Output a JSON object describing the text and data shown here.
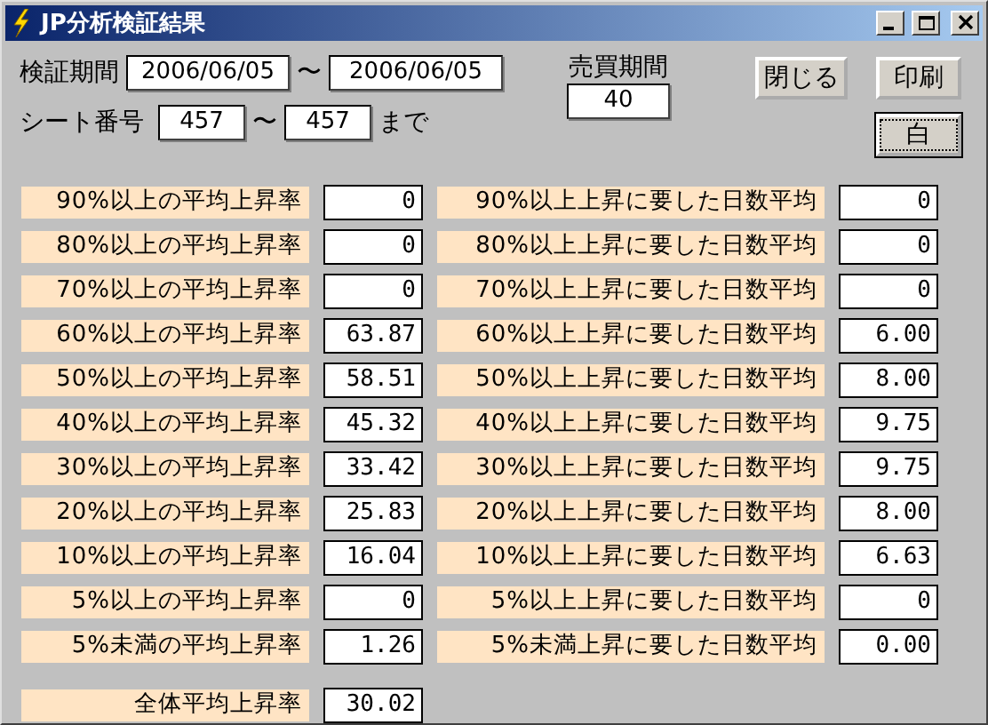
{
  "window": {
    "title": "JP分析検証結果"
  },
  "period": {
    "label": "検証期間",
    "from": "2006/06/05",
    "separator": "〜",
    "to": "2006/06/05"
  },
  "sheet": {
    "label": "シート番号",
    "from": "457",
    "separator": "〜",
    "to": "457",
    "suffix": "まで"
  },
  "trade_period": {
    "label": "売買期間",
    "value": "40"
  },
  "buttons": [
    {
      "label": "閉じる",
      "default": false
    },
    {
      "label": "印刷",
      "default": false
    },
    {
      "label": "白",
      "default": true
    }
  ],
  "rise_rates": [
    {
      "label": "90%以上の平均上昇率",
      "value": "0"
    },
    {
      "label": "80%以上の平均上昇率",
      "value": "0"
    },
    {
      "label": "70%以上の平均上昇率",
      "value": "0"
    },
    {
      "label": "60%以上の平均上昇率",
      "value": "63.87"
    },
    {
      "label": "50%以上の平均上昇率",
      "value": "58.51"
    },
    {
      "label": "40%以上の平均上昇率",
      "value": "45.32"
    },
    {
      "label": "30%以上の平均上昇率",
      "value": "33.42"
    },
    {
      "label": "20%以上の平均上昇率",
      "value": "25.83"
    },
    {
      "label": "10%以上の平均上昇率",
      "value": "16.04"
    },
    {
      "label": "5%以上の平均上昇率",
      "value": "0"
    },
    {
      "label": "5%未満の平均上昇率",
      "value": "1.26"
    }
  ],
  "rise_days": [
    {
      "label": "90%以上上昇に要した日数平均",
      "value": "0"
    },
    {
      "label": "80%以上上昇に要した日数平均",
      "value": "0"
    },
    {
      "label": "70%以上上昇に要した日数平均",
      "value": "0"
    },
    {
      "label": "60%以上上昇に要した日数平均",
      "value": "6.00"
    },
    {
      "label": "50%以上上昇に要した日数平均",
      "value": "8.00"
    },
    {
      "label": "40%以上上昇に要した日数平均",
      "value": "9.75"
    },
    {
      "label": "30%以上上昇に要した日数平均",
      "value": "9.75"
    },
    {
      "label": "20%以上上昇に要した日数平均",
      "value": "8.00"
    },
    {
      "label": "10%以上上昇に要した日数平均",
      "value": "6.63"
    },
    {
      "label": "5%以上上昇に要した日数平均",
      "value": "0"
    },
    {
      "label": "5%未満上昇に要した日数平均",
      "value": "0.00"
    }
  ],
  "overall": {
    "label": "全体平均上昇率",
    "value": "30.02"
  }
}
